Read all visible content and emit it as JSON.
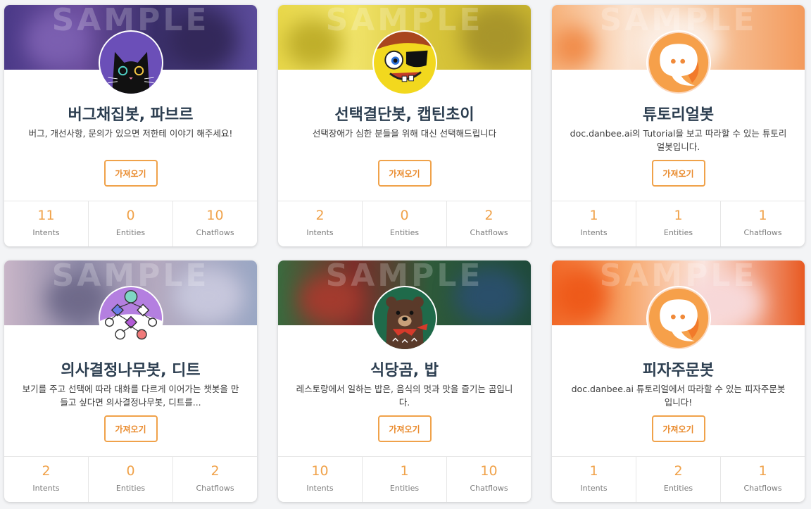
{
  "watermark": "SAMPLE",
  "colors": {
    "accent": "#f0a24a",
    "title": "#2c3e50"
  },
  "cards": [
    {
      "name": "버그채집봇, 파브르",
      "description": "버그, 개선사항, 문의가 있으면 저한테 이야기 해주세요!",
      "button": "가져오기",
      "avatar_icon": "black-cat-icon",
      "stats": [
        {
          "value": "11",
          "label": "Intents"
        },
        {
          "value": "0",
          "label": "Entities"
        },
        {
          "value": "10",
          "label": "Chatflows"
        }
      ]
    },
    {
      "name": "선택결단봇, 캡틴초이",
      "description": "선택장애가 심한 분들을 위해 대신 선택해드립니다",
      "button": "가져오기",
      "avatar_icon": "pirate-sponge-icon",
      "stats": [
        {
          "value": "2",
          "label": "Intents"
        },
        {
          "value": "0",
          "label": "Entities"
        },
        {
          "value": "2",
          "label": "Chatflows"
        }
      ]
    },
    {
      "name": "튜토리얼봇",
      "description": "doc.danbee.ai의 Tutorial을 보고 따라할 수 있는 튜토리얼봇입니다.",
      "button": "가져오기",
      "avatar_icon": "chat-bubble-icon",
      "stats": [
        {
          "value": "1",
          "label": "Intents"
        },
        {
          "value": "1",
          "label": "Entities"
        },
        {
          "value": "1",
          "label": "Chatflows"
        }
      ]
    },
    {
      "name": "의사결정나무봇, 디트",
      "description": "보기를 주고 선택에 따라 대화를 다르게 이어가는 챗봇을 만들고 싶다면 의사결정나무봇, 디트를...",
      "button": "가져오기",
      "avatar_icon": "decision-tree-icon",
      "stats": [
        {
          "value": "2",
          "label": "Intents"
        },
        {
          "value": "0",
          "label": "Entities"
        },
        {
          "value": "2",
          "label": "Chatflows"
        }
      ]
    },
    {
      "name": "식당곰, 밥",
      "description": "레스토랑에서 일하는 밥은, 음식의 멋과 맛을 즐기는 곰입니다.",
      "button": "가져오기",
      "avatar_icon": "bear-icon",
      "stats": [
        {
          "value": "10",
          "label": "Intents"
        },
        {
          "value": "1",
          "label": "Entities"
        },
        {
          "value": "10",
          "label": "Chatflows"
        }
      ]
    },
    {
      "name": "피자주문봇",
      "description": "doc.danbee.ai 튜토리얼에서 따라할 수 있는 피자주문봇입니다!",
      "button": "가져오기",
      "avatar_icon": "chat-bubble-icon",
      "stats": [
        {
          "value": "1",
          "label": "Intents"
        },
        {
          "value": "2",
          "label": "Entities"
        },
        {
          "value": "1",
          "label": "Chatflows"
        }
      ]
    }
  ]
}
